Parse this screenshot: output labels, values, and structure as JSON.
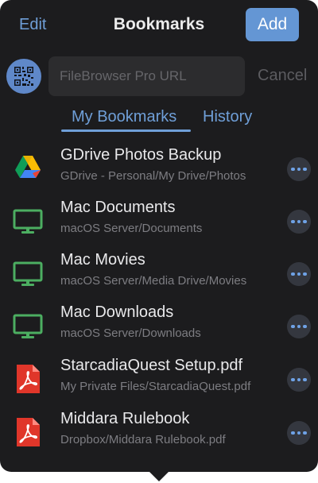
{
  "header": {
    "edit_label": "Edit",
    "title": "Bookmarks",
    "add_label": "Add"
  },
  "url_bar": {
    "placeholder": "FileBrowser Pro URL",
    "cancel_label": "Cancel"
  },
  "tabs": [
    {
      "label": "My Bookmarks",
      "selected": true
    },
    {
      "label": "History",
      "selected": false
    }
  ],
  "colors": {
    "accent": "#6f9fd8",
    "background": "#1c1c1e",
    "monitor_icon": "#4cae61",
    "pdf_icon": "#e0362a"
  },
  "bookmarks": [
    {
      "title": "GDrive Photos Backup",
      "path": "GDrive - Personal/My Drive/Photos",
      "icon": "google-drive-icon"
    },
    {
      "title": "Mac Documents",
      "path": "macOS Server/Documents",
      "icon": "monitor-icon"
    },
    {
      "title": "Mac Movies",
      "path": "macOS Server/Media Drive/Movies",
      "icon": "monitor-icon"
    },
    {
      "title": "Mac Downloads",
      "path": "macOS Server/Downloads",
      "icon": "monitor-icon"
    },
    {
      "title": "StarcadiaQuest Setup.pdf",
      "path": "My Private Files/StarcadiaQuest.pdf",
      "icon": "pdf-icon"
    },
    {
      "title": "Middara Rulebook",
      "path": "Dropbox/Middara Rulebook.pdf",
      "icon": "pdf-icon"
    }
  ]
}
